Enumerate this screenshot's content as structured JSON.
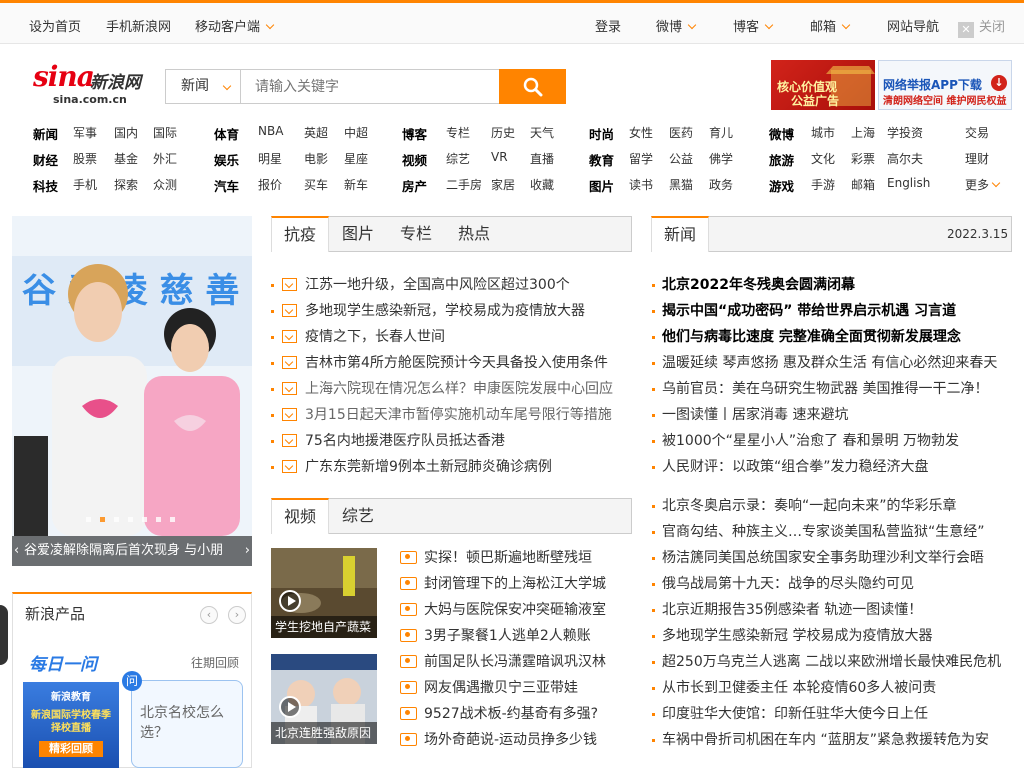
{
  "topbar": {
    "left": [
      "设为首页",
      "手机新浪网",
      "移动客户端"
    ],
    "right": [
      "登录",
      "微博",
      "博客",
      "邮箱",
      "网站导航"
    ],
    "close": "关闭"
  },
  "logo": {
    "brand": "sina",
    "name": "新浪网",
    "domain": "sina.com.cn"
  },
  "search": {
    "category": "新闻",
    "placeholder": "请输入关键字"
  },
  "ads": [
    {
      "line1": "核心价值观",
      "line2": "公益广告"
    },
    {
      "line1": "网络举报APP下载",
      "line2": "清朗网络空间  维护网民权益"
    }
  ],
  "nav": [
    {
      "rows": [
        [
          "新闻",
          "军事",
          "国内",
          "国际"
        ],
        [
          "财经",
          "股票",
          "基金",
          "外汇"
        ],
        [
          "科技",
          "手机",
          "探索",
          "众测"
        ]
      ]
    },
    {
      "rows": [
        [
          "体育",
          "NBA",
          "英超",
          "中超"
        ],
        [
          "娱乐",
          "明星",
          "电影",
          "星座"
        ],
        [
          "汽车",
          "报价",
          "买车",
          "新车"
        ]
      ]
    },
    {
      "rows": [
        [
          "博客",
          "专栏",
          "历史",
          "天气"
        ],
        [
          "视频",
          "综艺",
          "VR",
          "直播"
        ],
        [
          "房产",
          "二手房",
          "家居",
          "收藏"
        ]
      ]
    },
    {
      "rows": [
        [
          "时尚",
          "女性",
          "医药",
          "育儿"
        ],
        [
          "教育",
          "留学",
          "公益",
          "佛学"
        ],
        [
          "图片",
          "读书",
          "黑猫",
          "政务"
        ]
      ]
    },
    {
      "rows": [
        [
          "微博",
          "城市",
          "上海",
          "学投资"
        ],
        [
          "旅游",
          "文化",
          "彩票",
          "高尔夫"
        ],
        [
          "游戏",
          "手游",
          "邮箱",
          "English"
        ]
      ]
    },
    {
      "rows": [
        [
          "交易"
        ],
        [
          "理财"
        ],
        [
          "更多"
        ]
      ]
    }
  ],
  "slideshow": {
    "caption": "谷爱凌解除隔离后首次现身 与小朋",
    "banner_text": "谷 爱 凌 慈 善"
  },
  "products": {
    "title": "新浪产品",
    "daily": "每日一问",
    "past": "往期回顾",
    "edu_line1": "新浪教育",
    "edu_line2": "新浪国际学校春季择校直播",
    "edu_line3": "精彩回顾",
    "ask_icon": "问",
    "ask_text": "北京名校怎么选？"
  },
  "tabs1": [
    "抗疫",
    "图片",
    "专栏",
    "热点"
  ],
  "list1": [
    {
      "text": "江苏一地升级，全国高中风险区超过300个",
      "gray": false
    },
    {
      "text": "多地现学生感染新冠，学校易成为疫情放大器",
      "gray": false
    },
    {
      "text": "疫情之下，长春人世间",
      "gray": false
    },
    {
      "text": "吉林市第4所方舱医院预计今天具备投入使用条件",
      "gray": false
    },
    {
      "text": "上海六院现在情况怎么样？申康医院发展中心回应",
      "gray": true
    },
    {
      "text": "3月15日起天津市暂停实施机动车尾号限行等措施",
      "gray": true
    },
    {
      "text": "75名内地援港医疗队员抵达香港",
      "gray": false
    },
    {
      "text": "广东东莞新增9例本土新冠肺炎确诊病例",
      "gray": false
    }
  ],
  "tabs2": [
    "视频",
    "综艺"
  ],
  "videos": [
    {
      "caption": "学生挖地自产蔬菜"
    },
    {
      "caption": "北京连胜强敌原因"
    }
  ],
  "list2": [
    "实探！顿巴斯遍地断壁残垣",
    "封闭管理下的上海松江大学城",
    "大妈与医院保安冲突砸输液室",
    "3男子聚餐1人逃单2人赖账",
    "前国足队长冯潇霆暗讽巩汉林",
    "网友偶遇撒贝宁三亚带娃",
    "9527战术板-约基奇有多强?",
    "场外奇葩说-运动员挣多少钱"
  ],
  "news_tab": "新闻",
  "news_date": "2022.3.15",
  "news_bold": [
    "北京2022年冬残奥会圆满闭幕",
    "揭示中国“成功密码” 带给世界启示机遇 习言道",
    "他们与病毒比速度 完整准确全面贯彻新发展理念"
  ],
  "news1": [
    "温暖延续 琴声悠扬 惠及群众生活 有信心必然迎来春天",
    "乌前官员：美在乌研究生物武器 美国推得一干二净！",
    "一图读懂丨居家消毒 速来避坑",
    "被1000个“星星小人”治愈了 春和景明 万物勃发",
    "人民财评：以政策“组合拳”发力稳经济大盘"
  ],
  "news2": [
    "北京冬奥启示录：奏响“一起向未来”的华彩乐章",
    "官商勾结、种族主义…专家谈美国私营监狱“生意经”",
    "杨洁篪同美国总统国家安全事务助理沙利文举行会晤",
    "俄乌战局第十九天：战争的尽头隐约可见",
    "北京近期报告35例感染者 轨迹一图读懂！",
    "多地现学生感染新冠 学校易成为疫情放大器",
    "超250万乌克兰人逃离 二战以来欧洲增长最快难民危机",
    "从市长到卫健委主任 本轮疫情60多人被问责",
    "印度驻华大使馆：印新任驻华大使今日上任",
    "车祸中骨折司机困在车内 “蓝朋友”紧急救援转危为安"
  ]
}
